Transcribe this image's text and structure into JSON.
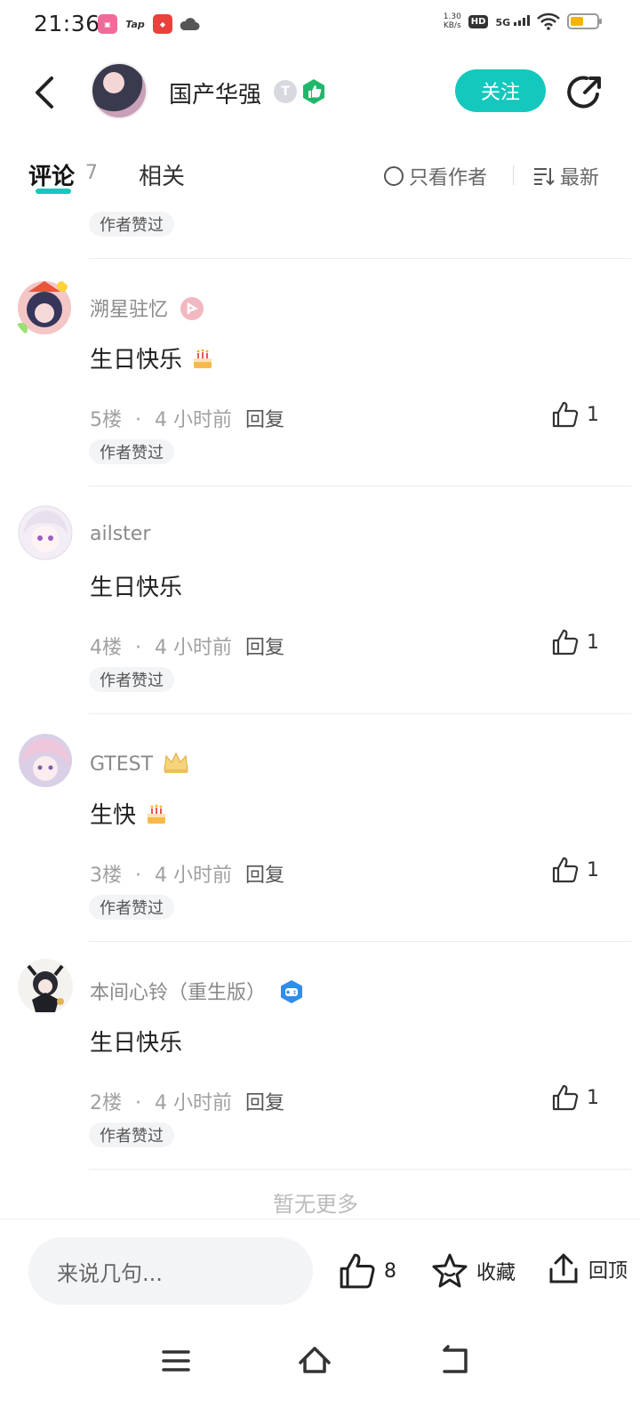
{
  "status_bar": {
    "time": "21:36",
    "apps": [
      "bilibili",
      "Tap",
      "app"
    ],
    "speed_value": "1.30",
    "speed_unit": "KB/s",
    "hd": "HD",
    "network": "5G"
  },
  "header": {
    "author_name": "国产华强",
    "badge_letter": "T",
    "follow_label": "关注"
  },
  "tabs": {
    "comments_label": "评论",
    "comments_count": "7",
    "related_label": "相关",
    "only_author_label": "只看作者",
    "sort_label": "最新"
  },
  "top_partial_tag": "作者赞过",
  "comments": [
    {
      "user": "溯星驻忆",
      "text": "生日快乐",
      "floor": "5楼",
      "time": "4 小时前",
      "reply_label": "回复",
      "likes": "1",
      "tag": "作者赞过",
      "has_cake": true
    },
    {
      "user": "ailster",
      "text": "生日快乐",
      "floor": "4楼",
      "time": "4 小时前",
      "reply_label": "回复",
      "likes": "1",
      "tag": "作者赞过",
      "has_cake": false
    },
    {
      "user": "GTEST",
      "text": "生快",
      "floor": "3楼",
      "time": "4 小时前",
      "reply_label": "回复",
      "likes": "1",
      "tag": "作者赞过",
      "has_cake": true
    },
    {
      "user": "本间心铃（重生版）",
      "text": "生日快乐",
      "floor": "2楼",
      "time": "4 小时前",
      "reply_label": "回复",
      "likes": "1",
      "tag": "作者赞过",
      "has_cake": false
    }
  ],
  "meta_separator": "·",
  "end_text": "暂无更多",
  "bottom_bar": {
    "input_placeholder": "来说几句...",
    "like_count": "8",
    "favorite_label": "收藏",
    "top_label": "回顶"
  },
  "colors": {
    "accent": "#14c8bd",
    "follow_text": "#ffffff",
    "meta_gray": "#a0a0a0"
  }
}
